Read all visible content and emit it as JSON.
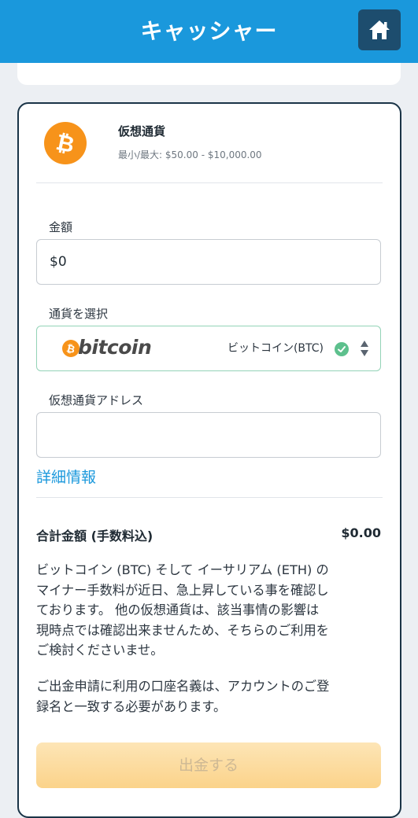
{
  "header": {
    "title": "キャッシャー"
  },
  "method": {
    "name": "仮想通貨",
    "limits": "最小/最大: $50.00 - $10,000.00",
    "logo_glyph": "₿"
  },
  "form": {
    "amount_label": "金額",
    "amount_value": "$0",
    "currency_label": "通貨を選択",
    "currency_logo_text": "bitcoin",
    "currency_selected": "ビットコイン(BTC)",
    "address_label": "仮想通貨アドレス",
    "address_value": "",
    "details_link": "詳細情報"
  },
  "summary": {
    "total_label": "合計金額 (手数料込)",
    "total_value": "$0.00"
  },
  "notice": {
    "paragraph1": "ビットコイン (BTC) そして イーサリアム (ETH) の\nマイナー手数料が近日、急上昇している事を確認し\nております。 他の仮想通貨は、該当事情の影響は\n現時点では確認出来ませんため、そちらのご利用を\nご検討くださいませ。",
    "paragraph2": "ご出金申請に利用の口座名義は、アカウントのご登\n録名と一致する必要があります。"
  },
  "submit": {
    "label": "出金する"
  },
  "colors": {
    "header_bg": "#1a98dc",
    "home_button_bg": "#1d4d6e",
    "bitcoin_orange": "#f7931a",
    "link": "#1a98dc",
    "check_green": "#5dc08d",
    "submit_bg": "#fbd38a"
  },
  "icons": {
    "home": "home-icon",
    "bitcoin": "bitcoin-icon",
    "check": "check-circle-icon",
    "sort": "sort-arrows-icon"
  }
}
